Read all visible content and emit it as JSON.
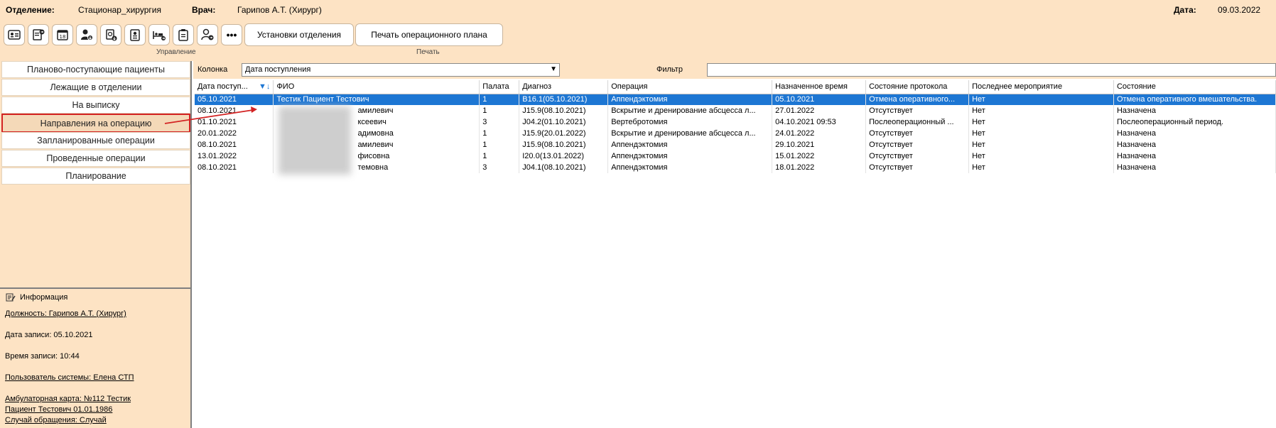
{
  "header": {
    "department_label": "Отделение:",
    "department_value": "Стационар_хирургия",
    "doctor_label": "Врач:",
    "doctor_value": "Гарипов А.Т. (Хирург)",
    "date_label": "Дата:",
    "date_value": "09.03.2022"
  },
  "toolbar": {
    "icons": [
      "id-card-icon",
      "document-arrow-icon",
      "calendar-18-icon",
      "user-download-icon",
      "document-download-icon",
      "badge-icon",
      "bed-arrow-icon",
      "clipboard-icon",
      "user-arrow-icon",
      "more-icon"
    ],
    "calendar_number": "18",
    "more_label": "•••",
    "settings_button": "Установки отделения",
    "print_plan_button": "Печать операционного плана",
    "group_manage": "Управление",
    "group_print": "Печать"
  },
  "sidebar": {
    "items": [
      {
        "label": "Планово-поступающие пациенты"
      },
      {
        "label": "Лежащие в отделении"
      },
      {
        "label": "На выписку"
      },
      {
        "label": "Направления на операцию"
      },
      {
        "label": "Запланированные операции"
      },
      {
        "label": "Проведенные операции"
      },
      {
        "label": "Планирование"
      }
    ],
    "active_index": 3
  },
  "info": {
    "title": "Информация",
    "position": "Должность: Гарипов А.Т. (Хирург)",
    "record_date": "Дата записи: 05.10.2021",
    "record_time": "Время записи: 10:44",
    "system_user": "Пользователь системы: Елена  СТП",
    "card_line1": "Амбулаторная карта: №112 Тестик ",
    "card_line2": "Пациент Тестович 01.01.1986",
    "case_line": "Случай обращения: Случай "
  },
  "filter": {
    "column_label": "Колонка",
    "column_value": "Дата поступления",
    "filter_label": "Фильтр",
    "filter_value": ""
  },
  "table": {
    "columns": [
      "Дата поступ...",
      "ФИО",
      "Палата",
      "Диагноз",
      "Операция",
      "Назначенное время",
      "Состояние протокола",
      "Последнее мероприятие",
      "Состояние"
    ],
    "rows": [
      [
        "05.10.2021",
        "Тестик Пациент Тестович",
        "1",
        "B16.1(05.10.2021)",
        "Аппендэктомия",
        "05.10.2021",
        "Отмена оперативного...",
        "Нет",
        "Отмена оперативного вмешательства."
      ],
      [
        "08.10.2021",
        "амилевич",
        "1",
        "J15.9(08.10.2021)",
        "Вскрытие и дренирование абсцесса л...",
        "27.01.2022",
        "Отсутствует",
        "Нет",
        "Назначена"
      ],
      [
        "01.10.2021",
        "ксеевич",
        "3",
        "J04.2(01.10.2021)",
        "Вертебротомия",
        "04.10.2021 09:53",
        "Послеоперационный ...",
        "Нет",
        "Послеоперационный период."
      ],
      [
        "20.01.2022",
        "адимовна",
        "1",
        "J15.9(20.01.2022)",
        "Вскрытие и дренирование абсцесса л...",
        "24.01.2022",
        "Отсутствует",
        "Нет",
        "Назначена"
      ],
      [
        "08.10.2021",
        "амилевич",
        "1",
        "J15.9(08.10.2021)",
        "Аппендэктомия",
        "29.10.2021",
        "Отсутствует",
        "Нет",
        "Назначена"
      ],
      [
        "13.01.2022",
        "фисовна",
        "1",
        "I20.0(13.01.2022)",
        "Аппендэктомия",
        "15.01.2022",
        "Отсутствует",
        "Нет",
        "Назначена"
      ],
      [
        "08.10.2021",
        "темовна",
        "3",
        "J04.1(08.10.2021)",
        "Аппендэктомия",
        "18.01.2022",
        "Отсутствует",
        "Нет",
        "Назначена"
      ]
    ],
    "selected_row": 0,
    "sort_icon": "sort-desc-filter-icon"
  },
  "colors": {
    "panel_bg": "#fde3c4",
    "selection": "#1d76d3",
    "highlight_border": "#d32323"
  }
}
